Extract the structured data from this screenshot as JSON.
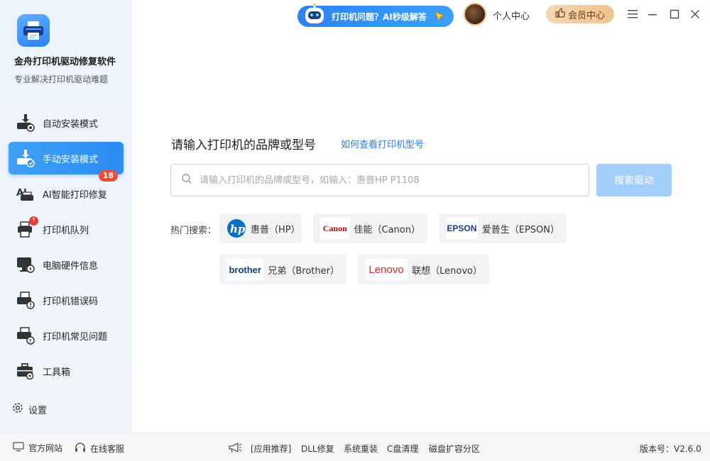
{
  "app": {
    "name": "金舟打印机驱动修复软件",
    "subtitle": "专业解决打印机驱动难题"
  },
  "sidebar": {
    "items": [
      {
        "label": "自动安装模式",
        "icon": "auto-install-icon"
      },
      {
        "label": "手动安装模式",
        "icon": "manual-install-icon",
        "active": true
      },
      {
        "label": "AI智能打印修复",
        "icon": "ai-print-repair-icon",
        "badge": "18"
      },
      {
        "label": "打印机队列",
        "icon": "printer-queue-icon",
        "dot": "!"
      },
      {
        "label": "电脑硬件信息",
        "icon": "hardware-info-icon"
      },
      {
        "label": "打印机错误码",
        "icon": "error-code-icon"
      },
      {
        "label": "打印机常见问题",
        "icon": "faq-icon"
      },
      {
        "label": "工具箱",
        "icon": "toolbox-icon"
      }
    ],
    "settings_label": "设置"
  },
  "topbar": {
    "ai_banner": "打印机问题？AI秒级解答",
    "personal_center": "个人中心",
    "vip_label": "会员中心"
  },
  "main": {
    "search_title": "请输入打印机的品牌或型号",
    "help_link": "如何查看打印机型号",
    "search_placeholder": "请输入打印机的品牌或型号，如输入：惠普HP P1108",
    "search_value": "",
    "search_button": "搜索驱动",
    "hot_label": "热门搜索：",
    "brands": [
      {
        "logo": "hp",
        "label": "惠普（HP）"
      },
      {
        "logo": "Canon",
        "label": "佳能（Canon）"
      },
      {
        "logo": "EPSON",
        "label": "爱普生（EPSON）"
      },
      {
        "logo": "brother",
        "label": "兄弟（Brother）"
      },
      {
        "logo": "Lenovo",
        "label": "联想（Lenovo）"
      }
    ]
  },
  "footer": {
    "website": "官方网站",
    "service": "在线客服",
    "app_recommend": "[应用推荐]",
    "links": [
      "DLL修复",
      "系统重装",
      "C盘清理",
      "磁盘扩容分区"
    ],
    "version": "版本号：V2.6.0"
  },
  "colors": {
    "accent": "#2c8cf0",
    "badge": "#f24b36",
    "search_button": "#a3cdfa",
    "vip": "#efc28f"
  }
}
